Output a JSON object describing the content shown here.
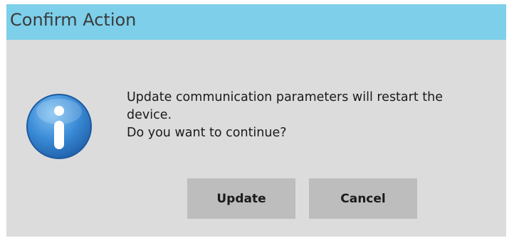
{
  "dialog": {
    "title": "Confirm Action",
    "icon": "info-icon",
    "message_lines": [
      "Update communication parameters will restart the",
      "device.",
      "Do you want to continue?"
    ],
    "buttons": {
      "update_label": "Update",
      "cancel_label": "Cancel"
    }
  },
  "colors": {
    "titlebar": "#7dcfea",
    "dialog_background": "#dcdcdc",
    "button_background": "#bdbdbd",
    "icon_blue": "#2f7fc8"
  }
}
